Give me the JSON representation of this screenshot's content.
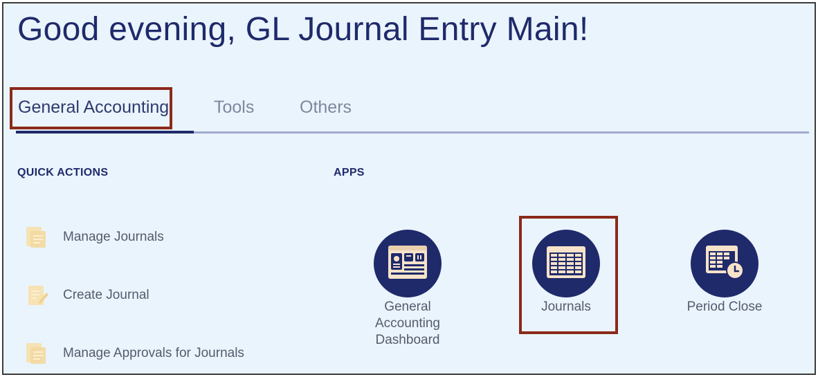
{
  "greeting": "Good evening, GL Journal Entry Main!",
  "tabs": [
    {
      "label": "General Accounting",
      "active": true
    },
    {
      "label": "Tools",
      "active": false
    },
    {
      "label": "Others",
      "active": false
    }
  ],
  "quick_actions": {
    "title": "QUICK ACTIONS",
    "items": [
      {
        "label": "Manage Journals",
        "icon": "document-stack-icon"
      },
      {
        "label": "Create Journal",
        "icon": "document-edit-icon"
      },
      {
        "label": "Manage Approvals for Journals",
        "icon": "document-stack-icon"
      }
    ]
  },
  "apps": {
    "title": "APPS",
    "items": [
      {
        "label": "General Accounting Dashboard",
        "icon": "dashboard-icon"
      },
      {
        "label": "Journals",
        "icon": "journals-grid-icon"
      },
      {
        "label": "Period Close",
        "icon": "period-close-icon"
      }
    ]
  },
  "colors": {
    "background": "#eaf4fc",
    "brand_navy": "#1f2a6b",
    "highlight_box": "#8b2a1a",
    "quick_action_icon": "#f6e2b3",
    "app_icon_fill": "#f7e3c9"
  }
}
